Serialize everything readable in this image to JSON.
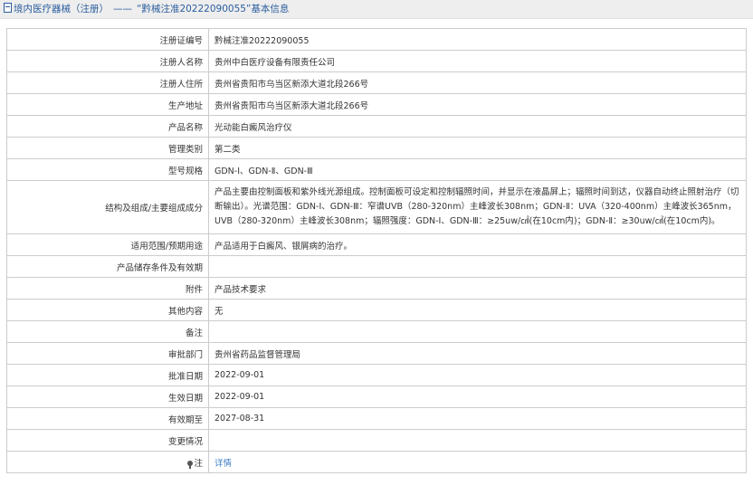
{
  "header": {
    "breadcrumb_root": "境内医疗器械（注册）",
    "separator": "——",
    "title": "“黔械注准20222090055”基本信息"
  },
  "rows": [
    {
      "label": "注册证编号",
      "value": "黔械注准20222090055"
    },
    {
      "label": "注册人名称",
      "value": "贵州中白医疗设备有限责任公司"
    },
    {
      "label": "注册人住所",
      "value": "贵州省贵阳市乌当区新添大道北段266号"
    },
    {
      "label": "生产地址",
      "value": "贵州省贵阳市乌当区新添大道北段266号"
    },
    {
      "label": "产品名称",
      "value": "光动能白癜风治疗仪"
    },
    {
      "label": "管理类别",
      "value": "第二类"
    },
    {
      "label": "型号规格",
      "value": "GDN-Ⅰ、GDN-Ⅱ、GDN-Ⅲ"
    },
    {
      "label": "结构及组成/主要组成成分",
      "value": "产品主要由控制面板和紫外线光源组成。控制面板可设定和控制辐照时间，并显示在液晶屏上；辐照时间到达，仪器自动终止照射治疗（切断输出）。光谱范围：GDN-Ⅰ、GDN-Ⅲ：窄谱UVB（280-320nm）主峰波长308nm；GDN-Ⅱ：UVA（320-400nm）主峰波长365nm，UVB（280-320nm）主峰波长308nm；辐照强度：GDN-Ⅰ、GDN-Ⅲ：≥25uw/㎠(在10cm内)；GDN-Ⅱ：≥30uw/㎠(在10cm内)。"
    },
    {
      "label": "适用范围/预期用途",
      "value": "产品适用于白癜风、银屑病的治疗。"
    },
    {
      "label": "产品储存条件及有效期",
      "value": ""
    },
    {
      "label": "附件",
      "value": "产品技术要求"
    },
    {
      "label": "其他内容",
      "value": "无"
    },
    {
      "label": "备注",
      "value": ""
    },
    {
      "label": "审批部门",
      "value": "贵州省药品监督管理局"
    },
    {
      "label": "批准日期",
      "value": "2022-09-01"
    },
    {
      "label": "生效日期",
      "value": "2022-09-01"
    },
    {
      "label": "有效期至",
      "value": "2027-08-31"
    },
    {
      "label": "变更情况",
      "value": ""
    }
  ],
  "footer_row": {
    "label": "注",
    "link": "详情",
    "icon": "pin-icon"
  },
  "colors": {
    "title": "#2a5d9f",
    "link": "#3d7ec8",
    "border": "#cccccc",
    "header_bg": "#eeeeee"
  }
}
